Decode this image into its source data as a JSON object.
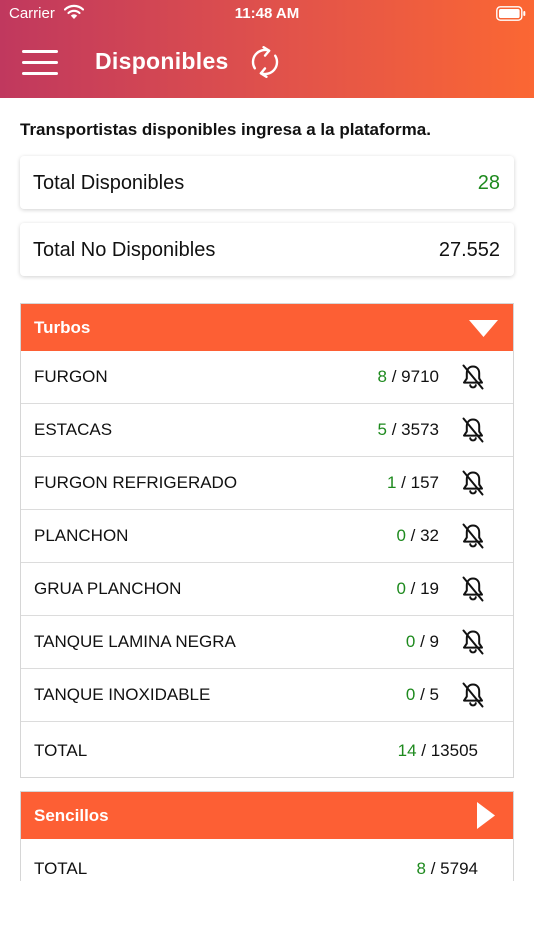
{
  "status_bar": {
    "carrier": "Carrier",
    "time": "11:48 AM"
  },
  "header": {
    "title": "Disponibles",
    "menu_icon": "hamburger-menu-icon",
    "refresh_icon": "refresh-icon"
  },
  "intro": "Transportistas disponibles ingresa a la plataforma.",
  "summary": {
    "available_label": "Total Disponibles",
    "available_value": "28",
    "unavailable_label": "Total No Disponibles",
    "unavailable_value": "27.552"
  },
  "sections": {
    "turbos": {
      "title": "Turbos",
      "expanded": true,
      "rows": [
        {
          "label": "FURGON",
          "available": "8",
          "separator": " / ",
          "total": "9710"
        },
        {
          "label": "ESTACAS",
          "available": "5",
          "separator": " / ",
          "total": "3573"
        },
        {
          "label": "FURGON REFRIGERADO",
          "available": "1",
          "separator": " / ",
          "total": "157"
        },
        {
          "label": "PLANCHON",
          "available": "0",
          "separator": " / ",
          "total": "32"
        },
        {
          "label": "GRUA PLANCHON",
          "available": "0",
          "separator": " / ",
          "total": "19"
        },
        {
          "label": "TANQUE LAMINA NEGRA",
          "available": "0",
          "separator": " / ",
          "total": "9"
        },
        {
          "label": "TANQUE INOXIDABLE",
          "available": "0",
          "separator": " / ",
          "total": "5"
        }
      ],
      "total": {
        "label": "TOTAL",
        "available": "14",
        "separator": " / ",
        "total": "13505"
      }
    },
    "sencillos": {
      "title": "Sencillos",
      "expanded": false,
      "total": {
        "label": "TOTAL",
        "available": "8",
        "separator": " / ",
        "total": "5794"
      }
    }
  },
  "colors": {
    "accent": "#fd5f34",
    "available": "#1e8a1e",
    "header_start": "#c0385e",
    "header_end": "#fb6733"
  }
}
